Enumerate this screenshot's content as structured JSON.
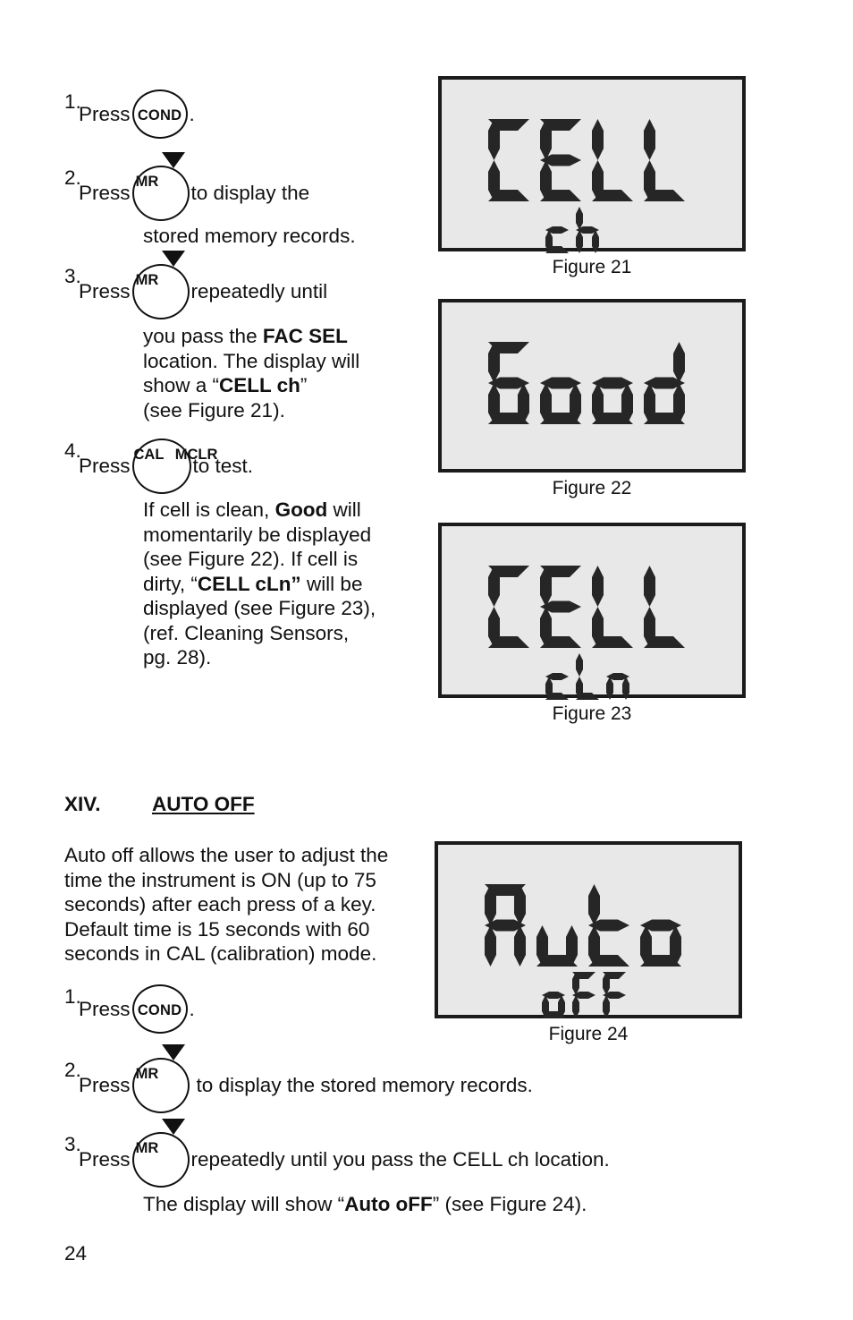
{
  "page": {
    "number": "24"
  },
  "section_top": {
    "steps": [
      {
        "num": "1.",
        "pre": "Press",
        "key": "COND",
        "post": "."
      },
      {
        "num": "2.",
        "pre": "Press",
        "key": "MR",
        "post": "to display the"
      },
      {
        "num": "3.",
        "pre": "Press",
        "key": "MR",
        "post": "repeatedly until"
      },
      {
        "num": "4.",
        "pre": "Press",
        "key": "CAL/MCLR",
        "post": "to test."
      }
    ],
    "step2_cont": "stored memory records.",
    "step3_cont": [
      {
        "t": "you pass the ",
        "b": "FAC SEL"
      },
      {
        "t": "location. The display will"
      },
      {
        "t": "show a “",
        "b": "CELL ch",
        "t2": "”"
      },
      {
        "t": "(see Figure 21)."
      }
    ],
    "step4_cont": [
      {
        "t": "If cell is clean, ",
        "b": "Good",
        "t2": " will"
      },
      {
        "t": "momentarily be displayed"
      },
      {
        "t": "(see Figure 22). If cell is"
      },
      {
        "t": "dirty, “",
        "b": "CELL cLn”",
        "t2": " will be"
      },
      {
        "t": "displayed (see Figure 23),"
      },
      {
        "t": "(ref. Cleaning Sensors,"
      },
      {
        "t": "pg. 28)."
      }
    ]
  },
  "section_auto": {
    "numeral": "XIV.",
    "title": "AUTO OFF",
    "paragraph": [
      "Auto off allows the user to adjust the",
      "time the instrument is ON (up to 75",
      "seconds) after each press of a key.",
      "Default time is 15 seconds with 60",
      "seconds in CAL (calibration) mode."
    ],
    "steps": [
      {
        "num": "1.",
        "pre": "Press",
        "key": "COND",
        "post": "."
      },
      {
        "num": "2.",
        "pre": "Press",
        "key": "MR",
        "post": "to display the stored memory records."
      },
      {
        "num": "3.",
        "pre": "Press",
        "key": "MR",
        "post": "repeatedly until you pass the CELL ch location."
      }
    ],
    "closing": {
      "t": "The display will show “",
      "b": "Auto oFF",
      "t2": "” (see Figure 24)."
    }
  },
  "keys": {
    "cond": {
      "label": "COND"
    },
    "mr": {
      "label": "MR",
      "arrow": "down-triangle"
    },
    "cal": {
      "top": "CAL",
      "bottom": "MCLR"
    }
  },
  "figures": [
    {
      "id": "figure-21",
      "caption": "Figure 21",
      "lcd_main": "CELL",
      "lcd_sub": "ch",
      "main_segments": [
        [
          "a",
          "f",
          "e",
          "d"
        ],
        [
          "a",
          "f",
          "g",
          "e",
          "d"
        ],
        [
          "f",
          "e",
          "d"
        ],
        [
          "f",
          "e",
          "d"
        ]
      ],
      "sub_segments": [
        [
          "g",
          "e",
          "d"
        ],
        [
          "f",
          "e",
          "g",
          "c"
        ]
      ]
    },
    {
      "id": "figure-22",
      "caption": "Figure 22",
      "lcd_main": "Good",
      "lcd_sub": "",
      "main_segments": [
        [
          "a",
          "f",
          "g",
          "e",
          "d",
          "c"
        ],
        [
          "g",
          "e",
          "d",
          "c"
        ],
        [
          "g",
          "e",
          "d",
          "c"
        ],
        [
          "b",
          "g",
          "e",
          "d",
          "c"
        ]
      ],
      "sub_segments": []
    },
    {
      "id": "figure-23",
      "caption": "Figure 23",
      "lcd_main": "CELL",
      "lcd_sub": "cLn",
      "main_segments": [
        [
          "a",
          "f",
          "e",
          "d"
        ],
        [
          "a",
          "f",
          "g",
          "e",
          "d"
        ],
        [
          "f",
          "e",
          "d"
        ],
        [
          "f",
          "e",
          "d"
        ]
      ],
      "sub_segments": [
        [
          "g",
          "e",
          "d"
        ],
        [
          "f",
          "e",
          "d"
        ],
        [
          "g",
          "e",
          "c"
        ]
      ]
    },
    {
      "id": "figure-24",
      "caption": "Figure 24",
      "lcd_main": "Auto",
      "lcd_sub": "oFF",
      "main_segments": [
        [
          "a",
          "b",
          "c",
          "f",
          "g",
          "e"
        ],
        [
          "e",
          "d",
          "c"
        ],
        [
          "f",
          "g",
          "e",
          "d"
        ],
        [
          "g",
          "e",
          "d",
          "c"
        ]
      ],
      "sub_segments": [
        [
          "g",
          "e",
          "d",
          "c"
        ],
        [
          "a",
          "f",
          "g",
          "e"
        ],
        [
          "a",
          "f",
          "g",
          "e"
        ]
      ]
    }
  ],
  "colors": {
    "lcd_background": "#e8e8e8",
    "lcd_segment": "#262626",
    "lcd_border": "#1b1b1b",
    "text": "#111111"
  }
}
